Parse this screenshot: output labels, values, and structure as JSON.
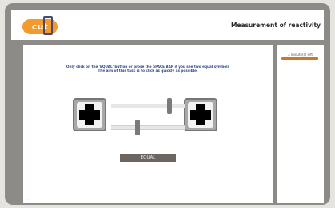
{
  "header": {
    "logo_text": "cut",
    "title": "Measurement of reactivity"
  },
  "side": {
    "timer_text": "3 minute(s) left",
    "timer_progress": 1.0
  },
  "task": {
    "instruction_line1": "Only click on the 'EQUAL' button or prose the SPACE BAR if you see two equal symbols",
    "instruction_line2": "The aim of this task is to click as quickly as possible.",
    "left_symbol_icon": "cross-icon",
    "right_symbol_icon": "cross-icon",
    "equal_label": "EQUAL"
  },
  "colors": {
    "brand": "#f29a2e",
    "instruction": "#2e4a86",
    "button": "#6d6560",
    "frame": "#8d8b88"
  }
}
